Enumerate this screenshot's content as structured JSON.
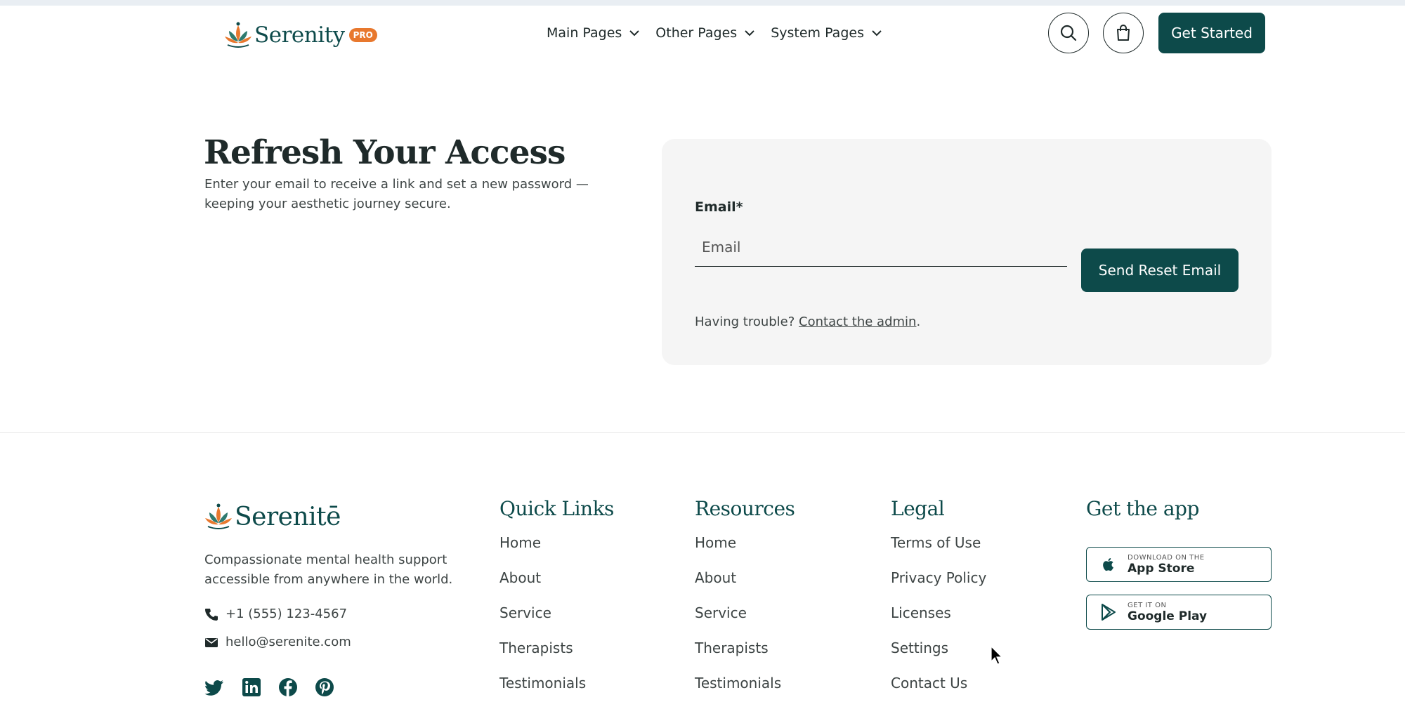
{
  "header": {
    "logo_text": "Serenity",
    "pro_badge": "PRO",
    "nav": [
      {
        "label": "Main Pages"
      },
      {
        "label": "Other Pages"
      },
      {
        "label": "System Pages"
      }
    ],
    "cta_label": "Get Started"
  },
  "hero": {
    "title": "Refresh Your Access",
    "subtitle": "Enter your email to receive a link and set a new password — keeping your aesthetic journey secure."
  },
  "form": {
    "email_label": "Email*",
    "email_placeholder": "Email",
    "email_value": "",
    "submit_label": "Send Reset Email",
    "trouble_prefix": "Having trouble? ",
    "trouble_link": "Contact the admin",
    "trouble_suffix": "."
  },
  "footer": {
    "logo_text": "Serenitē",
    "description": "Compassionate mental health support accessible from anywhere in the world.",
    "phone": "+1 (555) 123-4567",
    "email": "hello@serenite.com",
    "socials": [
      "twitter-icon",
      "linkedin-icon",
      "facebook-icon",
      "pinterest-icon"
    ],
    "quick_links": {
      "title": "Quick Links",
      "items": [
        "Home",
        "About",
        "Service",
        "Therapists",
        "Testimonials"
      ]
    },
    "resources": {
      "title": "Resources",
      "items": [
        "Home",
        "About",
        "Service",
        "Therapists",
        "Testimonials"
      ]
    },
    "legal": {
      "title": "Legal",
      "items": [
        "Terms of Use",
        "Privacy Policy",
        "Licenses",
        "Settings",
        "Contact Us"
      ]
    },
    "app": {
      "title": "Get the app",
      "apple_small": "DOWNLOAD ON THE",
      "apple_big": "App Store",
      "google_small": "GET IT ON",
      "google_big": "Google Play"
    }
  },
  "colors": {
    "brand": "#0d4a4a",
    "accent": "#e8782e",
    "card_bg": "#f5f5f5"
  }
}
